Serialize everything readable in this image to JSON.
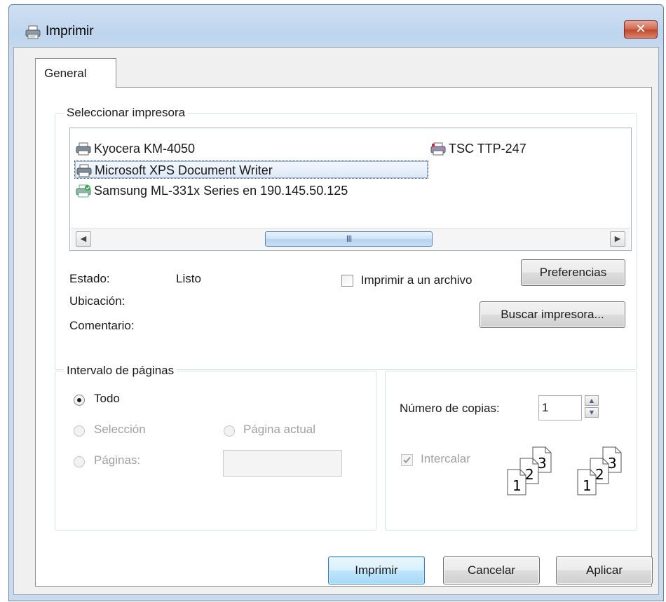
{
  "window": {
    "title": "Imprimir",
    "close_label": "✕"
  },
  "tabs": [
    {
      "label": "General"
    }
  ],
  "select_printer": {
    "legend": "Seleccionar impresora",
    "printers": [
      {
        "name": "Kyocera KM-4050",
        "icon": "printer-icon",
        "selected": false
      },
      {
        "name": "TSC TTP-247",
        "icon": "printer-icon",
        "selected": false
      },
      {
        "name": "Microsoft XPS Document Writer",
        "icon": "printer-icon",
        "selected": true
      },
      {
        "name": "Samsung ML-331x Series en 190.145.50.125",
        "icon": "network-printer-default-icon",
        "selected": false
      }
    ],
    "scrollbar": {
      "thumb_grip": "III"
    },
    "status_label": "Estado:",
    "status_value": "Listo",
    "location_label": "Ubicación:",
    "comment_label": "Comentario:",
    "print_to_file_label": "Imprimir a un archivo",
    "print_to_file_checked": false,
    "preferences_label": "Preferencias",
    "find_printer_label": "Buscar impresora..."
  },
  "page_range": {
    "legend": "Intervalo de páginas",
    "all_label": "Todo",
    "selection_label": "Selección",
    "current_page_label": "Página actual",
    "pages_label": "Páginas:",
    "pages_value": "",
    "selected_option": "Todo"
  },
  "copies": {
    "count_label": "Número de copias:",
    "count_value": "1",
    "collate_label": "Intercalar",
    "collate_checked": true,
    "collate_enabled": false,
    "page_numbers": [
      "1",
      "2",
      "3"
    ]
  },
  "footer": {
    "print_label": "Imprimir",
    "cancel_label": "Cancelar",
    "apply_label": "Aplicar"
  }
}
